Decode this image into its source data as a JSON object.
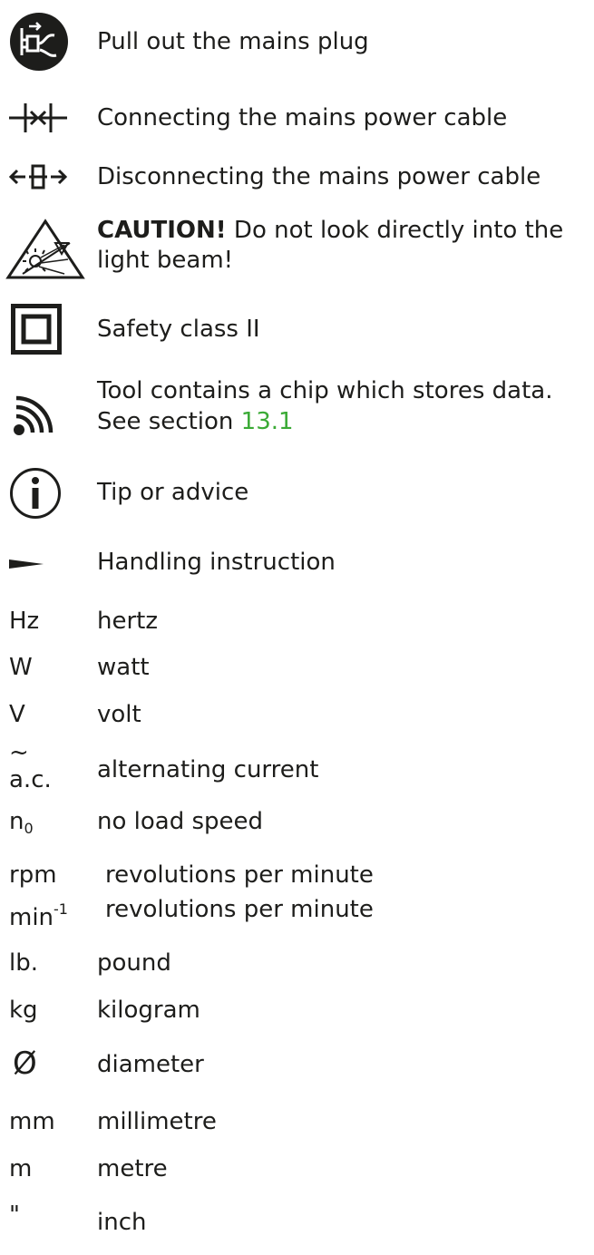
{
  "symbols": {
    "unplug": "Pull out the mains plug",
    "connect": "Connecting the mains power cable",
    "disconnect": "Disconnecting the mains power cable",
    "caution": {
      "label": "CAUTION!",
      "text_line1": " Do not look directly into the",
      "text_line2": "light beam!"
    },
    "safety_class": "Safety class II",
    "chip": {
      "line1": "Tool contains a chip which stores data.",
      "line2_prefix": "See section ",
      "section_ref": "13.1"
    },
    "tip": "Tip or advice",
    "instruction": "Handling instruction"
  },
  "units": {
    "hz": {
      "abbr": "Hz",
      "text": "hertz"
    },
    "w": {
      "abbr": "W",
      "text": "watt"
    },
    "v": {
      "abbr": "V",
      "text": "volt"
    },
    "ac": {
      "symbol": "~",
      "abbr": "a.c.",
      "text": "alternating current"
    },
    "n0": {
      "abbr": "n",
      "sub": "0",
      "text": "no load speed"
    },
    "rpm": {
      "abbr": "rpm",
      "text": "revolutions per minute"
    },
    "min": {
      "abbr": "min",
      "sup": "-1",
      "text": "revolutions per minute"
    },
    "lb": {
      "abbr": "lb.",
      "text": "pound"
    },
    "kg": {
      "abbr": "kg",
      "text": "kilogram"
    },
    "diameter": {
      "symbol": "Ø",
      "text": "diameter"
    },
    "mm": {
      "abbr": "mm",
      "text": "millimetre"
    },
    "m": {
      "abbr": "m",
      "text": "metre"
    },
    "inch": {
      "abbr": "\"",
      "text": "inch"
    }
  },
  "colors": {
    "text": "#1d1d1b",
    "link": "#3aaa35"
  },
  "icons": [
    "unplug-icon",
    "connect-cable-icon",
    "disconnect-cable-icon",
    "caution-light-beam-icon",
    "safety-class-ii-icon",
    "chip-wireless-icon",
    "info-icon",
    "handling-instruction-icon"
  ]
}
